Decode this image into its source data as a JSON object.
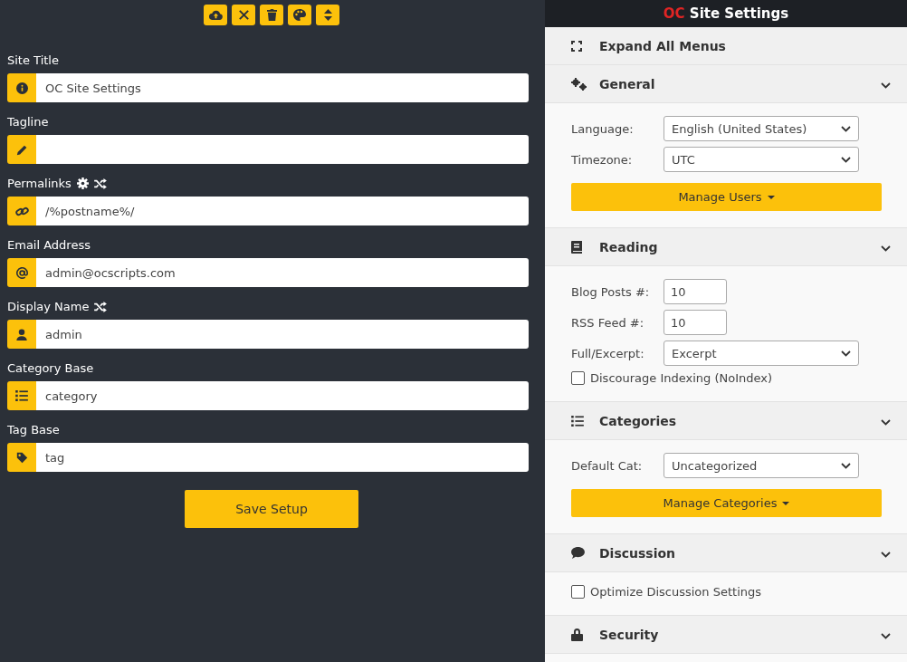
{
  "fields": [
    {
      "label": "Site Title",
      "value": "OC Site Settings"
    },
    {
      "label": "Tagline"
    },
    {
      "label": "Permalinks",
      "value": "/%postname%/"
    },
    {
      "label": "Email Address",
      "value": "admin@ocscripts.com"
    },
    {
      "label": "Display Name",
      "value": "admin"
    },
    {
      "label": "Category Base",
      "value": "category"
    },
    {
      "label": "Tag Base",
      "value": "tag"
    }
  ],
  "save_button": "Save Setup",
  "panel": {
    "title_brand": "OC",
    "title": "Site Settings",
    "expand_all": "Expand All Menus",
    "sections": [
      {
        "title": "General",
        "items": [
          {
            "kind": "select",
            "label": "Language:",
            "value": "English (United States)"
          },
          {
            "kind": "select",
            "label": "Timezone:",
            "value": "UTC"
          },
          {
            "kind": "button",
            "label": "Manage Users"
          }
        ]
      },
      {
        "title": "Reading",
        "items": [
          {
            "kind": "number",
            "label": "Blog Posts #:",
            "value": "10"
          },
          {
            "kind": "number",
            "label": "RSS Feed #:",
            "value": "10"
          },
          {
            "kind": "select",
            "label": "Full/Excerpt:",
            "value": "Excerpt"
          },
          {
            "kind": "checkbox",
            "label": "Discourage Indexing (NoIndex)",
            "checked": false
          }
        ]
      },
      {
        "title": "Categories",
        "items": [
          {
            "kind": "select",
            "label": "Default Cat:",
            "value": "Uncategorized"
          },
          {
            "kind": "button",
            "label": "Manage Categories"
          }
        ]
      },
      {
        "title": "Discussion",
        "items": [
          {
            "kind": "checkbox",
            "label": "Optimize Discussion Settings",
            "checked": false
          }
        ]
      },
      {
        "title": "Security"
      }
    ]
  }
}
